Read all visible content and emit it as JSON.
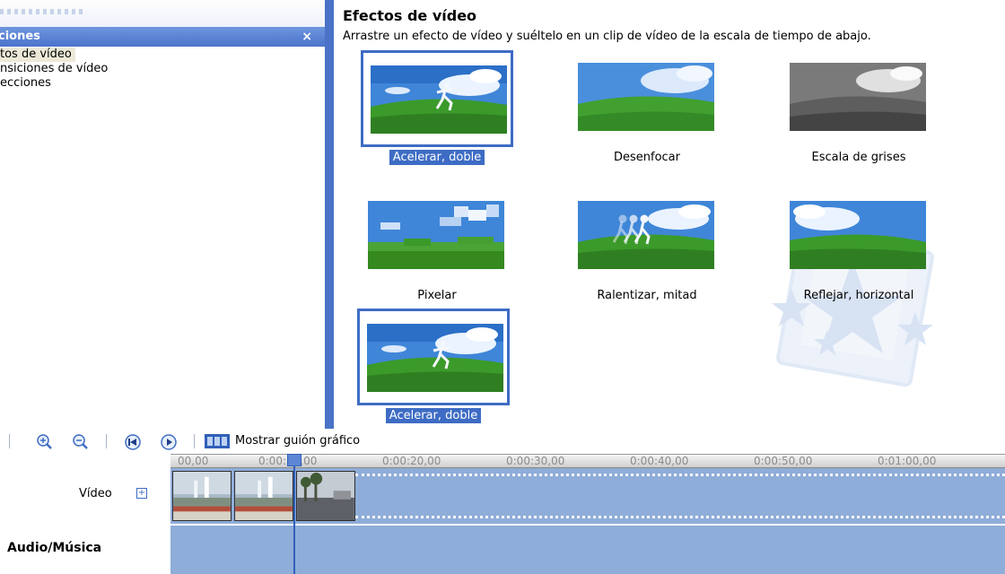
{
  "window": {
    "accent": "#4a72c7",
    "selection": "#3e6cc4",
    "track_color": "#8fadd9"
  },
  "left_pane": {
    "header_title": "ciones",
    "close_label": "×",
    "items": [
      {
        "label": "tos de vídeo",
        "selected": true
      },
      {
        "label": "nsiciones de vídeo",
        "selected": false
      },
      {
        "label": "ecciones",
        "selected": false
      }
    ]
  },
  "gallery": {
    "title": "Efectos de vídeo",
    "description": "Arrastre un efecto de vídeo y suéltelo en un clip de vídeo de la escala de tiempo de abajo.",
    "effects": [
      {
        "label": "Acelerar, doble",
        "selected": true,
        "variant": "runner-speed"
      },
      {
        "label": "Desenfocar",
        "selected": false,
        "variant": "blur"
      },
      {
        "label": "Escala de grises",
        "selected": false,
        "variant": "grayscale"
      },
      {
        "label": "Pixelar",
        "selected": false,
        "variant": "pixelate"
      },
      {
        "label": "Ralentizar, mitad",
        "selected": false,
        "variant": "runner-slow"
      },
      {
        "label": "Reflejar, horizontal",
        "selected": false,
        "variant": "mirror"
      },
      {
        "label": "Acelerar, doble",
        "selected": true,
        "variant": "runner-speed"
      }
    ]
  },
  "timeline": {
    "toolbar": {
      "zoom_in_icon": "zoom-in-icon",
      "zoom_out_icon": "zoom-out-icon",
      "rewind_icon": "rewind-icon",
      "play_icon": "play-icon",
      "storyboard_label": "Mostrar guión gráfico"
    },
    "ruler_ticks": [
      "00,00",
      "0:00:10,00",
      "0:00:20,00",
      "0:00:30,00",
      "0:00:40,00",
      "0:00:50,00",
      "0:01:00,00"
    ],
    "tracks": {
      "video_label": "Vídeo",
      "expand_label": "+",
      "audio_label": "Audio/Música"
    },
    "clips": [
      "fountain-clip",
      "fountain-clip",
      "street-clip"
    ]
  }
}
